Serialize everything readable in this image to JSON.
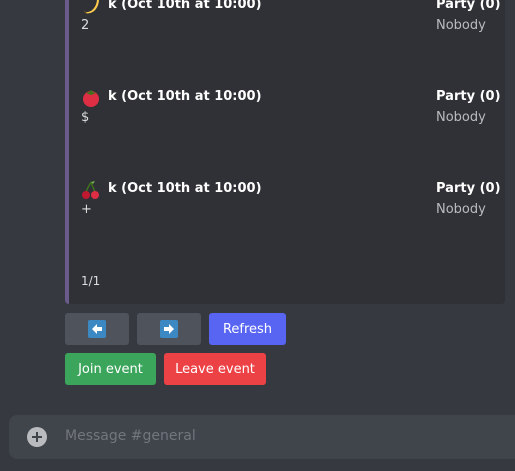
{
  "events": [
    {
      "emoji": "banana-icon",
      "title": "k (Oct 10th at 10:00)",
      "body": "2",
      "party_title": "Party (0)",
      "party_body": "Nobody"
    },
    {
      "emoji": "tomato-icon",
      "title": "k (Oct 10th at 10:00)",
      "body": "$",
      "party_title": "Party (0)",
      "party_body": "Nobody"
    },
    {
      "emoji": "cherries-icon",
      "title": "k (Oct 10th at 10:00)",
      "body": "+",
      "party_title": "Party (0)",
      "party_body": "Nobody"
    }
  ],
  "footer": "1/1",
  "buttons": {
    "refresh": "Refresh",
    "join": "Join event",
    "leave": "Leave event"
  },
  "composer": {
    "placeholder": "Message #general"
  },
  "colors": {
    "background": "#36393f",
    "embed": "#2f3136",
    "embed_border": "#6b5b8c",
    "blurple": "#5865f2",
    "green": "#3ba55c",
    "red": "#ed4245",
    "grey_button": "#4f545c"
  }
}
